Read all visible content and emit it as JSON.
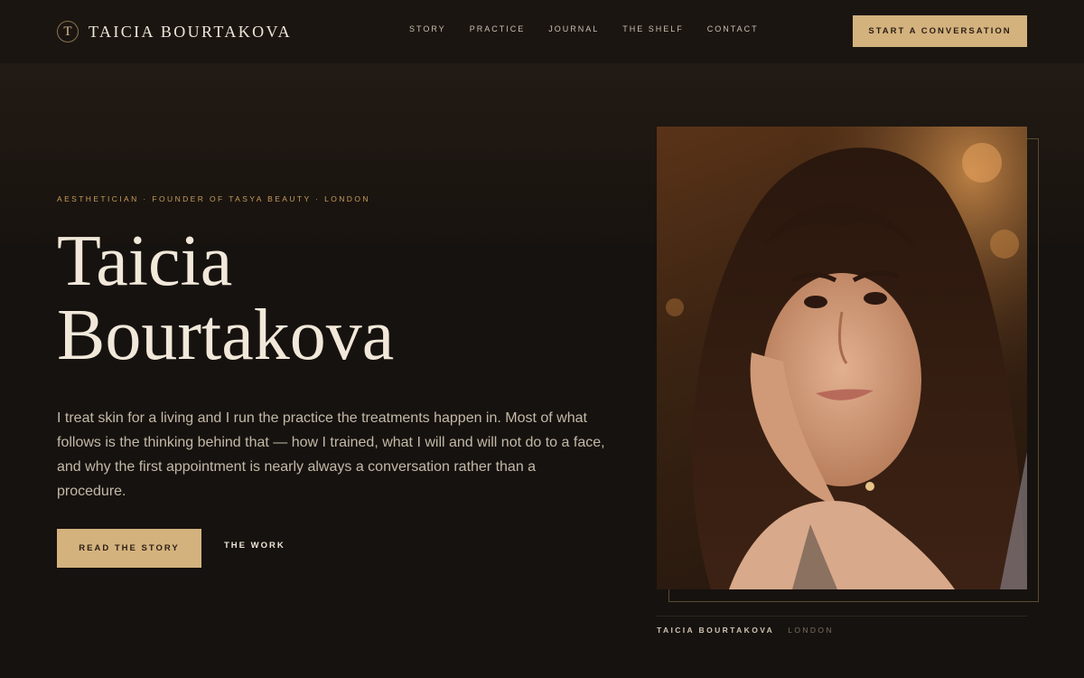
{
  "brand": {
    "mark": "T",
    "name": "TAICIA BOURTAKOVA"
  },
  "nav": {
    "items": [
      "STORY",
      "PRACTICE",
      "JOURNAL",
      "THE SHELF",
      "CONTACT"
    ],
    "cta": "START A CONVERSATION"
  },
  "hero": {
    "eyebrow": "AESTHETICIAN · FOUNDER OF TASYA BEAUTY · LONDON",
    "title_line1": "Taicia",
    "title_line2": "Bourtakova",
    "lede": "I treat skin for a living and I run the practice the treatments happen in. Most of what follows is the thinking behind that — how I trained, what I will and will not do to a face, and why the first appointment is nearly always a conversation rather than a procedure.",
    "primary_button": "READ THE STORY",
    "secondary_link": "THE WORK"
  },
  "portrait": {
    "caption_name": "TAICIA BOURTAKOVA",
    "caption_place": "LONDON"
  },
  "colors": {
    "background": "#16120f",
    "accent": "#d4b27e",
    "eyebrow": "#c79c5c",
    "text": "#f1e8da"
  }
}
